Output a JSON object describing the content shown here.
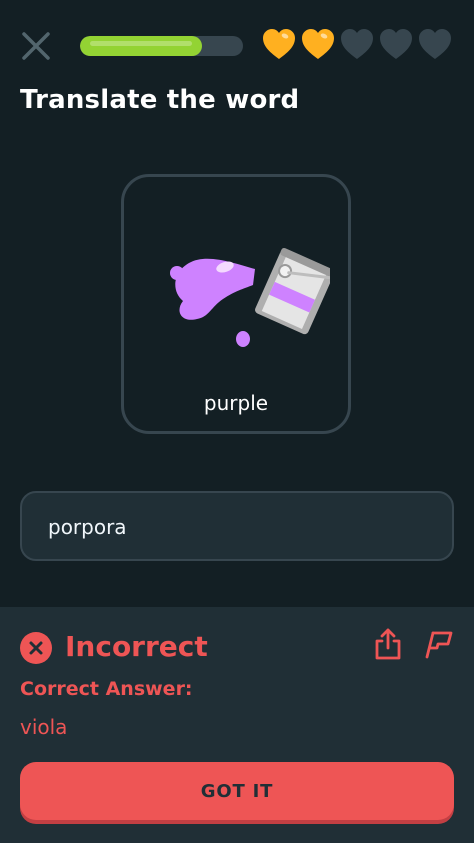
{
  "top_bar": {
    "close_icon": "close-icon",
    "progress": 0.75,
    "hearts_total": 5,
    "hearts_full": 2
  },
  "prompt": {
    "title": "Translate the word"
  },
  "card": {
    "word": "purple",
    "illustration": "purple-paint-bucket"
  },
  "answer": {
    "value": "porpora"
  },
  "feedback": {
    "status_icon": "x-circle-icon",
    "heading": "Incorrect",
    "correct_label": "Correct Answer:",
    "correct_value": "viola",
    "button_label": "GOT IT"
  },
  "colors": {
    "background": "#131f24",
    "panel": "#202f36",
    "border": "#37464f",
    "progress": "#93d333",
    "heart_full": "#ffb020",
    "heart_empty": "#37464f",
    "error": "#ee5555",
    "paint": "#ce82ff"
  }
}
